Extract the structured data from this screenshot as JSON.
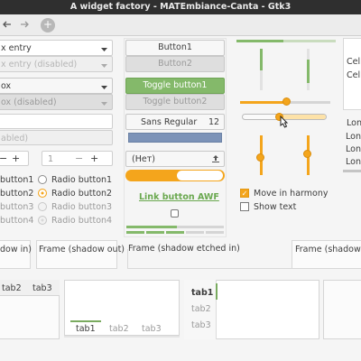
{
  "window": {
    "title": "A widget factory - MATEmbiance-Canta - Gtk3"
  },
  "header": {
    "back_icon": "back-arrow-icon",
    "forward_icon": "forward-arrow-icon",
    "add_label": "+"
  },
  "col1": {
    "combo_entry": "x entry",
    "combo_entry_disabled": "x entry (disabled)",
    "combo_box": "ox",
    "combo_box_disabled": "ox (disabled)",
    "entry_disabled": "abled)",
    "spin1_minus": "−",
    "spin1_plus": "+",
    "spin2_value": "1",
    "spin2_minus": "−",
    "spin2_plus": "+",
    "checks": [
      "button1",
      "button2",
      "button3",
      "button4"
    ],
    "radios": [
      "Radio button1",
      "Radio button2",
      "Radio button3",
      "Radio button4"
    ]
  },
  "col2": {
    "button1": "Button1",
    "button2": "Button2",
    "toggle1": "Toggle button1",
    "toggle2": "Toggle button2",
    "font_name": "Sans Regular",
    "font_size": "12",
    "file_chooser": "(Нет)",
    "link": "Link button AWF"
  },
  "col3": {
    "move_in_harmony": "Move in harmony",
    "show_text": "Show text"
  },
  "col4": {
    "cells": [
      "Cell",
      "Cell"
    ],
    "list": [
      "Lon",
      "Lon",
      "Lon",
      "Lon"
    ]
  },
  "frames": {
    "shadow_in": "dow in)",
    "shadow_out": "Frame (shadow out)",
    "shadow_etched_in": "Frame (shadow etched in)",
    "shadow_etched_out": "Frame (shadow e"
  },
  "notebooks": {
    "nb1_tabs": [
      "tab2",
      "tab3"
    ],
    "nb2_tabs": [
      "tab1",
      "tab2",
      "tab3"
    ],
    "nb3_tabs": [
      "tab1",
      "tab2",
      "tab3"
    ]
  }
}
